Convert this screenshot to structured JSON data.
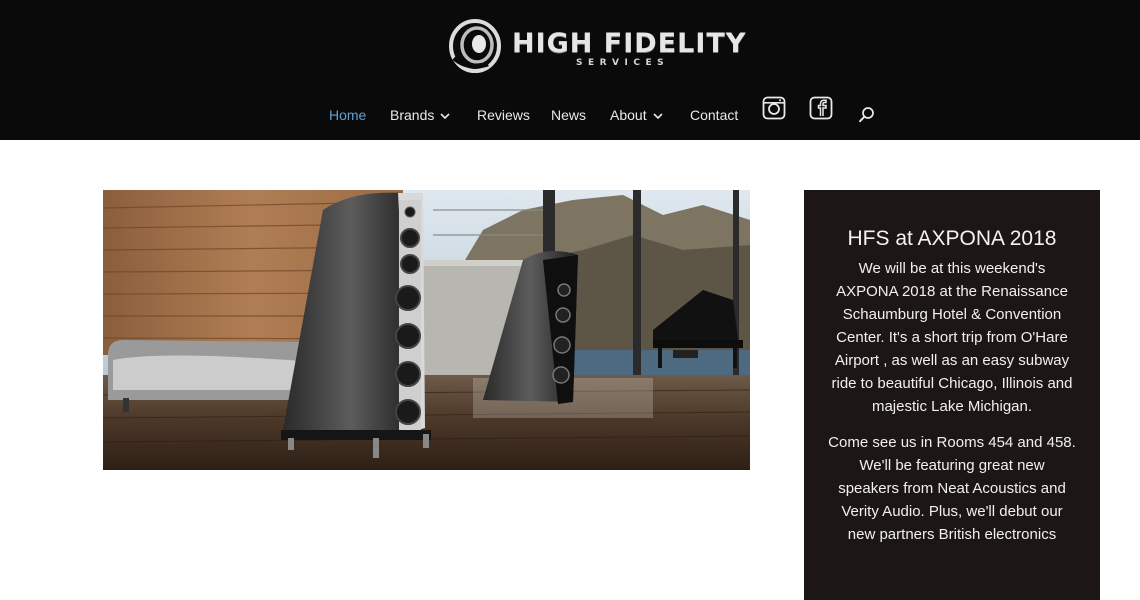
{
  "brand": {
    "name": "HIGH FIDELITY",
    "tagline": "SERVICES"
  },
  "nav": {
    "items": [
      {
        "label": "Home",
        "active": true
      },
      {
        "label": "Brands",
        "has_dropdown": true
      },
      {
        "label": "Reviews"
      },
      {
        "label": "News"
      },
      {
        "label": "About",
        "has_dropdown": true
      },
      {
        "label": "Contact"
      }
    ],
    "icons": [
      "instagram-icon",
      "facebook-icon",
      "search-icon"
    ]
  },
  "colors": {
    "header_bg": "#0a0a0a",
    "active_link": "#5fa3d6",
    "widget_bg": "#1c1714"
  },
  "hero": {
    "alt": "Tall black floor-standing speakers in a room with wood wall, grand piano and mountain view"
  },
  "widget": {
    "title": "HFS at AXPONA 2018",
    "paragraphs": [
      "We will be at this weekend's AXPONA 2018 at the Renaissance Schaumburg Hotel & Convention Center. It's a short trip from O'Hare Airport , as well as an easy subway ride to beautiful Chicago, Illinois and majestic Lake Michigan.",
      "Come see us in Rooms 454 and 458. We'll be featuring great new speakers from Neat Acoustics and Verity Audio. Plus, we'll debut our new partners British electronics"
    ]
  }
}
